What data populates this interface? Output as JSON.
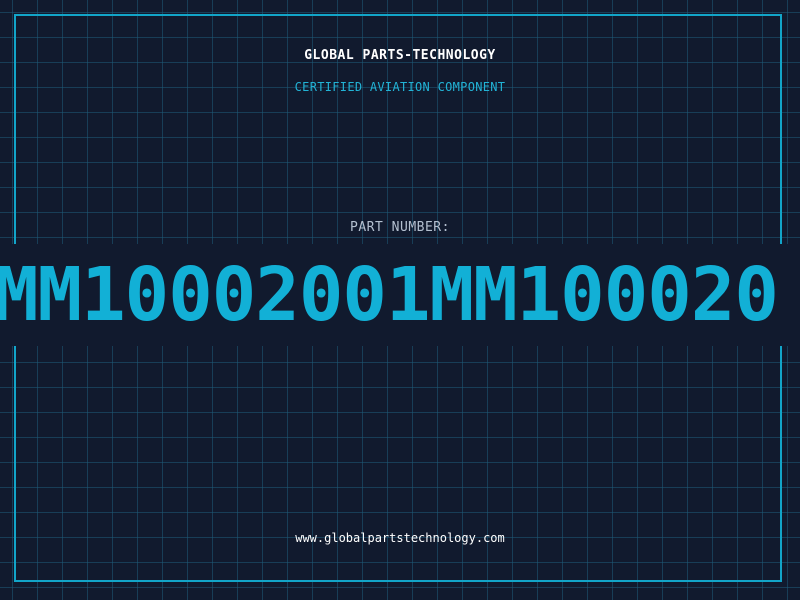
{
  "header": {
    "brand": "GLOBAL PARTS-TECHNOLOGY",
    "subtitle": "CERTIFIED AVIATION COMPONENT"
  },
  "part": {
    "label": "PART NUMBER:",
    "value": "MM10002001MM100020"
  },
  "footer": {
    "url": "www.globalpartstechnology.com"
  },
  "colors": {
    "background": "#111a2e",
    "grid": "#1e5a78",
    "accent": "#12b0d6",
    "frame": "#12a5c9",
    "label": "#b4c0d0",
    "text": "#ffffff"
  }
}
